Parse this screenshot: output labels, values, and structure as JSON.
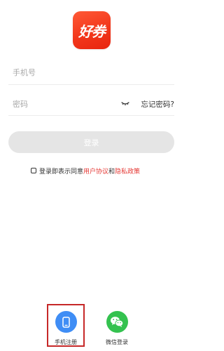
{
  "logo": {
    "text": "好券"
  },
  "form": {
    "phone_placeholder": "手机号",
    "password_placeholder": "密码",
    "forgot_label": "忘记密码?",
    "login_label": "登录"
  },
  "agreement": {
    "prefix": "登录即表示同意",
    "user_agreement": "用户协议",
    "and": "和",
    "privacy_policy": "隐私政策"
  },
  "social": {
    "phone_register_label": "手机注册",
    "wechat_login_label": "微信登录"
  },
  "colors": {
    "brand": "#f2371b",
    "link": "#e53935",
    "phone_icon_bg": "#3f8df5",
    "wechat_icon_bg": "#34c24f",
    "highlight_border": "#c62828",
    "login_button_bg": "#e5e5e5"
  },
  "icons": {
    "password_toggle": "eye-closed-icon",
    "phone_register": "smartphone-icon",
    "wechat_login": "wechat-icon"
  }
}
